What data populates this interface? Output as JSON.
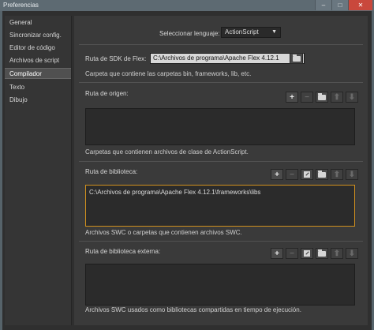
{
  "window": {
    "title": "Preferencias",
    "controls": {
      "minimize": "–",
      "maximize": "□",
      "close": "✕"
    }
  },
  "sidebar": {
    "items": [
      {
        "label": "General"
      },
      {
        "label": "Sincronizar config."
      },
      {
        "label": "Editor de código"
      },
      {
        "label": "Archivos de script"
      },
      {
        "label": "Compilador",
        "selected": true
      },
      {
        "label": "Texto"
      },
      {
        "label": "Dibujo"
      }
    ]
  },
  "main": {
    "language": {
      "label": "Seleccionar lenguaje:",
      "value": "ActionScript"
    },
    "sdk": {
      "label": "Ruta de SDK de Flex:",
      "value": "C:\\Archivos de programa\\Apache Flex 4.12.1",
      "hint": "Carpeta que contiene las carpetas bin, frameworks, lib, etc."
    },
    "source_path": {
      "label": "Ruta de origen:",
      "hint": "Carpetas que contienen archivos de clase de ActionScript."
    },
    "library_path": {
      "label": "Ruta de biblioteca:",
      "items": [
        "C:\\Archivos de programa\\Apache Flex 4.12.1\\frameworks\\libs"
      ],
      "hint": "Archivos SWC o carpetas que contienen archivos SWC."
    },
    "external_library_path": {
      "label": "Ruta de biblioteca externa:",
      "hint": "Archivos SWC usados como bibliotecas compartidas en tiempo de ejecución."
    },
    "buttons": {
      "add": "+",
      "remove": "−",
      "up": "⬆",
      "down": "⬇"
    }
  },
  "colors": {
    "focus_border": "#d0901e",
    "selected_item": "#505050",
    "close_button": "#c9483c"
  }
}
